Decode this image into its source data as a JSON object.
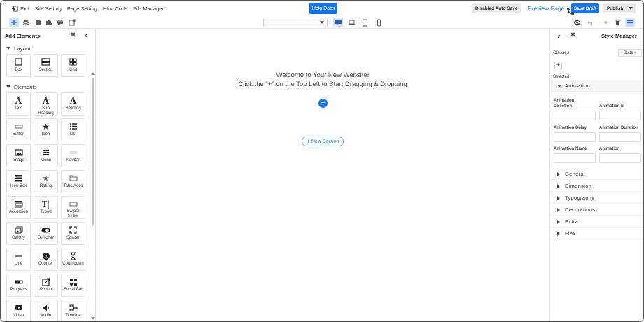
{
  "menu": {
    "exit": "Exit",
    "site_setting": "Site Setting",
    "page_setting": "Page Setting",
    "html_code": "Html Code",
    "file_manager": "File Manager",
    "help_docs": "Help Docs",
    "auto_save": "Disabled Auto Save",
    "preview_page": "Preview Page",
    "save_draft": "Save Draft",
    "publish": "Publish"
  },
  "left_panel": {
    "title": "Add Elements",
    "sections": [
      {
        "title": "Layout",
        "items": [
          {
            "label": "Box",
            "icon": "box-icon"
          },
          {
            "label": "Section",
            "icon": "section-icon"
          },
          {
            "label": "Grid",
            "icon": "grid-icon"
          }
        ]
      },
      {
        "title": "Elements",
        "items": [
          {
            "label": "Text",
            "icon": "text-icon"
          },
          {
            "label": "Sub Heading",
            "icon": "sub-heading-icon"
          },
          {
            "label": "Heading",
            "icon": "heading-icon"
          },
          {
            "label": "Button",
            "icon": "button-icon"
          },
          {
            "label": "Icon",
            "icon": "star-icon"
          },
          {
            "label": "List",
            "icon": "list-icon"
          },
          {
            "label": "Image",
            "icon": "image-icon"
          },
          {
            "label": "Menu",
            "icon": "menu-icon"
          },
          {
            "label": "Navbar",
            "icon": "navbar-icon"
          },
          {
            "label": "Icon Box",
            "icon": "icon-box-icon"
          },
          {
            "label": "Rating",
            "icon": "rating-icon"
          },
          {
            "label": "Tabs/Acco",
            "icon": "tabs-icon"
          },
          {
            "label": "Accordion",
            "icon": "accordion-icon"
          },
          {
            "label": "Typed",
            "icon": "typed-icon"
          },
          {
            "label": "Swiper Slider",
            "icon": "slider-icon"
          },
          {
            "label": "Gallery",
            "icon": "gallery-icon"
          },
          {
            "label": "Switcher",
            "icon": "switcher-icon"
          },
          {
            "label": "Spacer",
            "icon": "spacer-icon"
          },
          {
            "label": "Line",
            "icon": "line-icon"
          },
          {
            "label": "Counter",
            "icon": "counter-icon"
          },
          {
            "label": "Countdown",
            "icon": "hourglass-icon"
          },
          {
            "label": "Progress",
            "icon": "progress-icon"
          },
          {
            "label": "Popup",
            "icon": "popup-icon"
          },
          {
            "label": "Social Bar",
            "icon": "social-bar-icon"
          },
          {
            "label": "Video",
            "icon": "video-icon"
          },
          {
            "label": "Audio",
            "icon": "audio-icon"
          },
          {
            "label": "Timeline",
            "icon": "timeline-icon"
          }
        ]
      }
    ]
  },
  "canvas": {
    "welcome_line1": "Welcome to Your New Website!",
    "welcome_line2": "Click the \"+\" on the Top Left to Start Dragging & Dropping",
    "new_section": "New Section"
  },
  "right_panel": {
    "title": "Style Manager",
    "classes_label": "Classes",
    "state_value": "- State -",
    "selected_label": "Selected:",
    "animation_section": "Animation",
    "fields": {
      "animation_direction": "Animation Direction",
      "animation_id": "Animation Id",
      "animation_delay": "Animation Delay",
      "animation_duration": "Animation Duration",
      "animation_name": "Animation Name",
      "animation": "Animation"
    },
    "sections": [
      "General",
      "Dimension",
      "Typography",
      "Decorations",
      "Extra",
      "Flex"
    ]
  },
  "colors": {
    "accent": "#1a73e8",
    "active_bg": "#d6e4fb"
  }
}
